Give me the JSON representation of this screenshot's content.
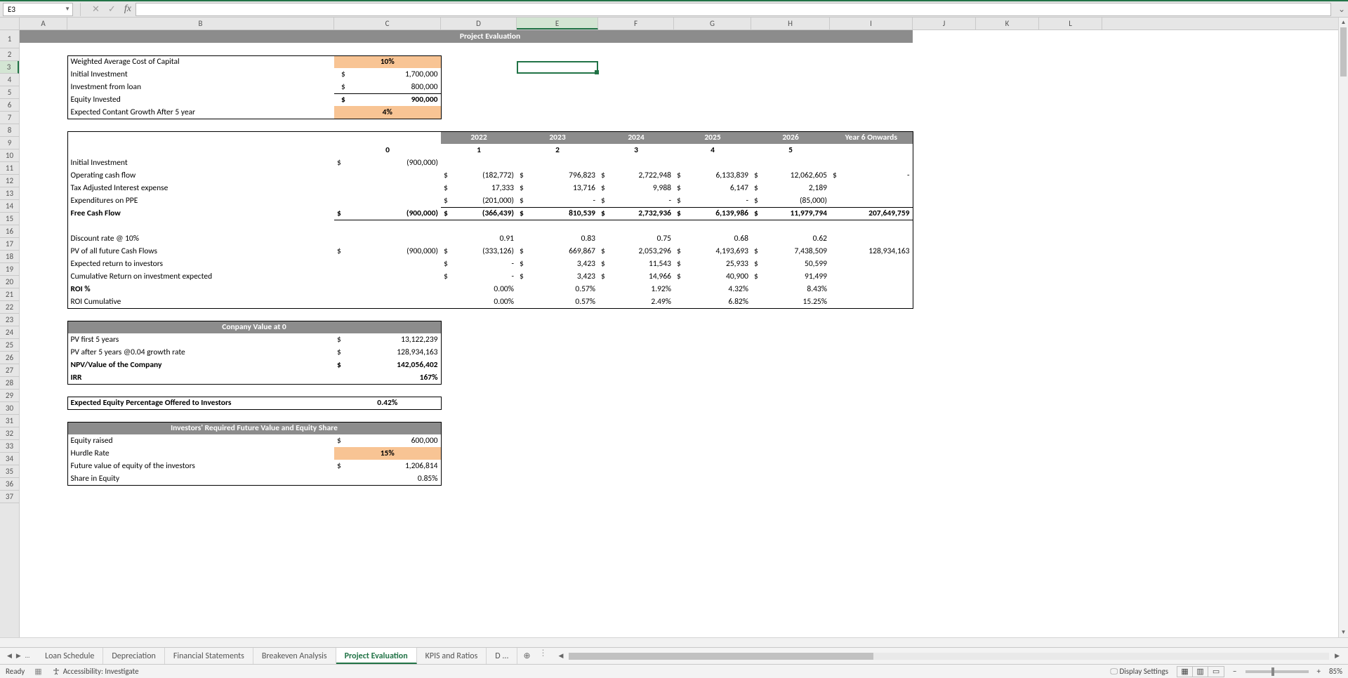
{
  "nameBox": "E3",
  "formula": "",
  "columns": [
    "A",
    "B",
    "C",
    "D",
    "E",
    "F",
    "G",
    "H",
    "I",
    "J",
    "K",
    "L"
  ],
  "rowsVisible": 37,
  "selectedCell": {
    "col": "E",
    "row": 3
  },
  "title": "Project Evaluation",
  "assumptions": {
    "wacc": {
      "label": "Weighted Average Cost of Capital",
      "value": "10%"
    },
    "initInvest": {
      "label": "Initial Investment",
      "curr": "$",
      "value": "1,700,000"
    },
    "loan": {
      "label": "Investment from loan",
      "curr": "$",
      "value": "800,000"
    },
    "equity": {
      "label": "Equity Invested",
      "curr": "$",
      "value": "900,000"
    },
    "growth": {
      "label": "Expected Contant Growth After 5 year",
      "value": "4%"
    }
  },
  "years": {
    "hdr": [
      "2022",
      "2023",
      "2024",
      "2025",
      "2026",
      "Year 6 Onwards"
    ],
    "idx": [
      "0",
      "1",
      "2",
      "3",
      "4",
      "5",
      ""
    ]
  },
  "cashflow": {
    "initInvest": {
      "label": "Initial Investment",
      "c0": "(900,000)"
    },
    "ocf": {
      "label": "Operating cash flow",
      "d": [
        "(182,772)",
        "796,823",
        "2,722,948",
        "6,133,839",
        "12,062,605",
        "-"
      ]
    },
    "tax": {
      "label": "Tax Adjusted Interest expense",
      "d": [
        "17,333",
        "13,716",
        "9,988",
        "6,147",
        "2,189",
        ""
      ]
    },
    "ppe": {
      "label": "Expenditures on PPE",
      "d": [
        "(201,000)",
        "-",
        "-",
        "-",
        "(85,000)",
        ""
      ]
    },
    "fcf": {
      "label": "Free Cash Flow",
      "c0": "(900,000)",
      "d": [
        "(366,439)",
        "810,539",
        "2,732,936",
        "6,139,986",
        "11,979,794",
        "207,649,759"
      ]
    }
  },
  "discount": {
    "rateLabel": "Discount rate @ 10%",
    "factors": [
      "0.91",
      "0.83",
      "0.75",
      "0.68",
      "0.62",
      ""
    ],
    "pv": {
      "label": "PV of all future Cash Flows",
      "c0": "(900,000)",
      "d": [
        "(333,126)",
        "669,867",
        "2,053,296",
        "4,193,693",
        "7,438,509",
        "128,934,163"
      ]
    },
    "ret": {
      "label": "Expected return to investors",
      "d": [
        "-",
        "3,423",
        "11,543",
        "25,933",
        "50,599",
        ""
      ]
    },
    "cum": {
      "label": "Cumulative Return on investment expected",
      "d": [
        "-",
        "3,423",
        "14,966",
        "40,900",
        "91,499",
        ""
      ]
    },
    "roi": {
      "label": "ROI %",
      "d": [
        "0.00%",
        "0.57%",
        "1.92%",
        "4.32%",
        "8.43%",
        ""
      ]
    },
    "roic": {
      "label": "ROI Cumulative",
      "d": [
        "0.00%",
        "0.57%",
        "2.49%",
        "6.82%",
        "15.25%",
        ""
      ]
    }
  },
  "companyValue": {
    "hdr": "Conpany Value at 0",
    "pv5": {
      "label": "PV first 5 years",
      "value": "13,122,239"
    },
    "pvAf": {
      "label": "PV after 5 years @0.04 growth rate",
      "value": "128,934,163"
    },
    "npv": {
      "label": "NPV/Value of the Company",
      "value": "142,056,402"
    },
    "irr": {
      "label": "IRR",
      "value": "167%"
    }
  },
  "expectedEquity": {
    "label": "Expected Equity Percentage Offered to Investors",
    "value": "0.42%"
  },
  "investors": {
    "hdr": "Investors' Required Future Value and Equity Share",
    "raised": {
      "label": "Equity raised",
      "value": "600,000"
    },
    "hurdle": {
      "label": "Hurdle Rate",
      "value": "15%"
    },
    "fv": {
      "label": "Future value of equity of the investors",
      "value": "1,206,814"
    },
    "share": {
      "label": "Share in Equity",
      "value": "0.85%"
    }
  },
  "tabs": [
    "Loan Schedule",
    "Depreciation",
    "Financial Statements",
    "Breakeven Analysis",
    "Project Evaluation",
    "KPIS and Ratios",
    "D ..."
  ],
  "activeTab": "Project Evaluation",
  "status": {
    "ready": "Ready",
    "acc": "Accessibility: Investigate",
    "display": "Display Settings",
    "zoom": "85%"
  }
}
